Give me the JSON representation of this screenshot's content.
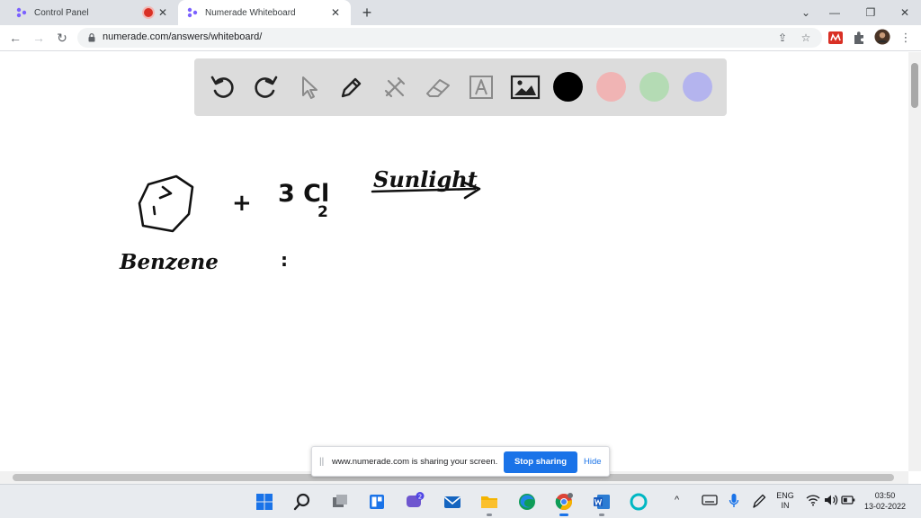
{
  "browser": {
    "tabs": [
      {
        "title": "Control Panel",
        "active": false,
        "recording": true
      },
      {
        "title": "Numerade Whiteboard",
        "active": true,
        "recording": false
      }
    ],
    "new_tab_label": "+",
    "address": "numerade.com/answers/whiteboard/"
  },
  "whiteboard": {
    "tools": [
      "undo-icon",
      "redo-icon",
      "pointer-icon",
      "pen-icon",
      "tools-icon",
      "eraser-icon",
      "text-icon",
      "image-icon"
    ],
    "colors": [
      "#000000",
      "#f0b4b4",
      "#b4dbb4",
      "#b4b4ee"
    ],
    "handwriting": {
      "plus": "+",
      "reagent": "3 Cl",
      "subscript": "2",
      "condition": "Sunlight",
      "name": "Benzene",
      "colon": ":"
    }
  },
  "share_banner": {
    "grip": "||",
    "message": "www.numerade.com is sharing your screen.",
    "stop_label": "Stop sharing",
    "hide_label": "Hide"
  },
  "taskbar": {
    "chat_badge": "2",
    "language_top": "ENG",
    "language_bottom": "IN",
    "time": "03:50",
    "date": "13-02-2022"
  }
}
